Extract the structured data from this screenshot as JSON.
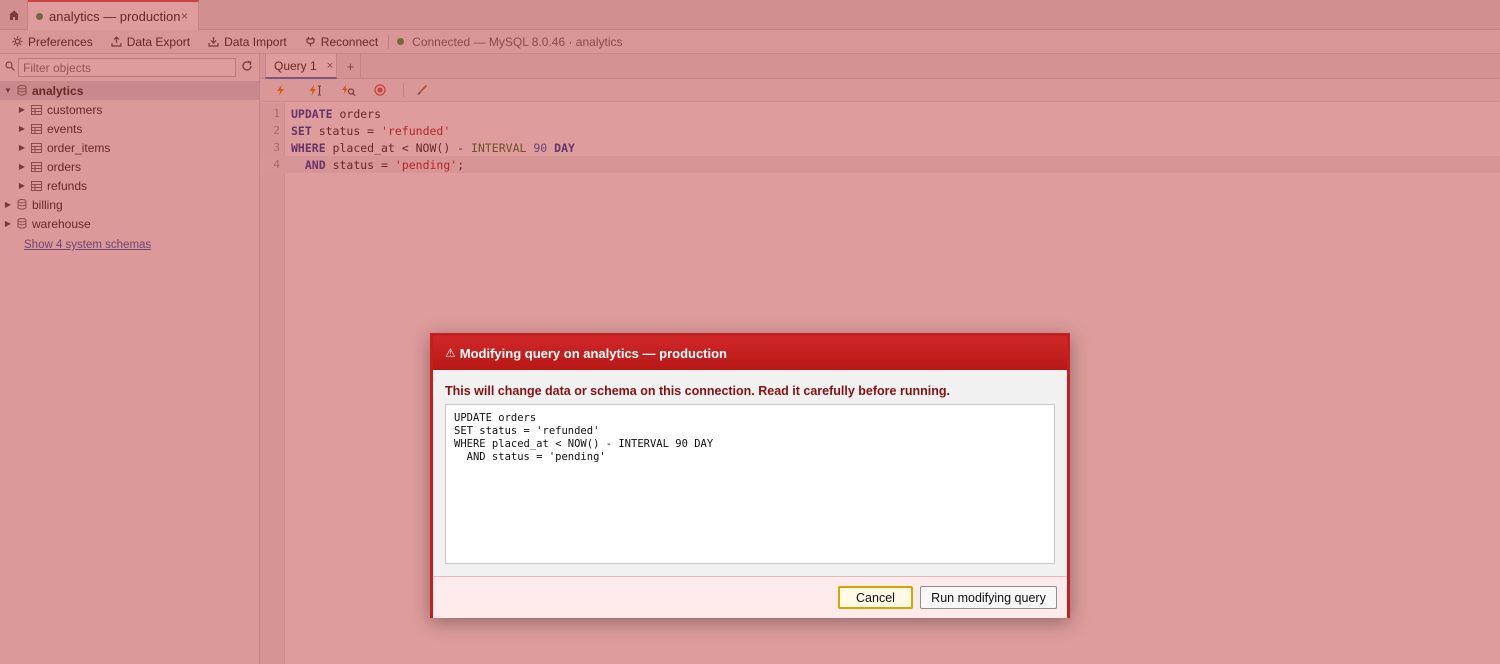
{
  "window": {
    "connection_tab": {
      "label": "analytics — production",
      "close": "×"
    }
  },
  "toolbar": {
    "preferences": "Preferences",
    "data_export": "Data Export",
    "data_import": "Data Import",
    "reconnect": "Reconnect",
    "status": "Connected — MySQL 8.0.46 · analytics",
    "status_color": "#3c9d4a"
  },
  "sidebar": {
    "filter_placeholder": "Filter objects",
    "schemas": [
      {
        "name": "analytics",
        "expanded": true,
        "tables": [
          "customers",
          "events",
          "order_items",
          "orders",
          "refunds"
        ]
      },
      {
        "name": "billing",
        "expanded": false
      },
      {
        "name": "warehouse",
        "expanded": false
      }
    ],
    "system_schemas_link": "Show 4 system schemas"
  },
  "editor": {
    "tab_label": "Query 1",
    "tab_close": "×",
    "add_tab": "+",
    "line_numbers": [
      "1",
      "2",
      "3",
      "4"
    ],
    "active_line": 4
  },
  "dialog": {
    "title": "Modifying query on analytics — production",
    "title_icon": "warning-icon",
    "message": "This will change data or schema on this connection. Read it carefully before running.",
    "sql": "UPDATE orders\nSET status = 'refunded'\nWHERE placed_at < NOW() - INTERVAL 90 DAY\n  AND status = 'pending'",
    "cancel_label": "Cancel",
    "run_label": "Run modifying query",
    "accent_color": "#c41e1e"
  }
}
